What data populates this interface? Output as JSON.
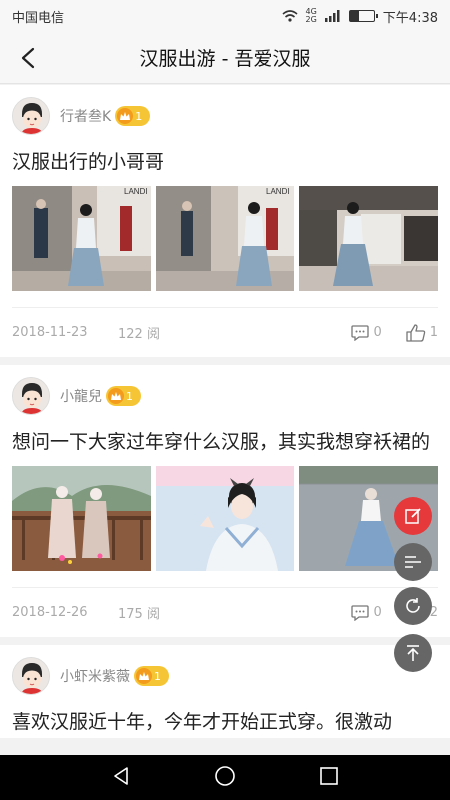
{
  "status_bar": {
    "carrier": "中国电信",
    "network_top": "4G",
    "network_bottom": "2G",
    "time": "下午4:38",
    "battery_level": 0.4
  },
  "header": {
    "title": "汉服出游 - 吾爱汉服",
    "back_icon": "chevron-left-icon"
  },
  "posts": [
    {
      "author": "行者叁K",
      "badge_level": "1",
      "title": "汉服出行的小哥哥",
      "date": "2018-11-23",
      "views": "122 阅",
      "comments": "0",
      "likes": "1",
      "images": [
        "photo-mall-hanfu-man-1",
        "photo-mall-hanfu-man-2",
        "photo-mall-hanfu-man-3"
      ]
    },
    {
      "author": "小龍兒",
      "badge_level": "1",
      "title": "想问一下大家过年穿什么汉服，其实我想穿袄裙的",
      "date": "2018-12-26",
      "views": "175 阅",
      "comments": "0",
      "likes": "2",
      "images": [
        "photo-couple-balcony",
        "photo-girl-selfie",
        "photo-girl-plaza"
      ]
    },
    {
      "author": "小虾米紫薇",
      "badge_level": "1",
      "title": "喜欢汉服近十年，今年才开始正式穿。很激动"
    }
  ],
  "floating_actions": [
    "edit-icon",
    "menu-icon",
    "refresh-icon",
    "scroll-top-icon"
  ],
  "colors": {
    "accent_red": "#e5393b",
    "badge_gold": "#f6c535",
    "muted_text": "#aaaaaa"
  }
}
